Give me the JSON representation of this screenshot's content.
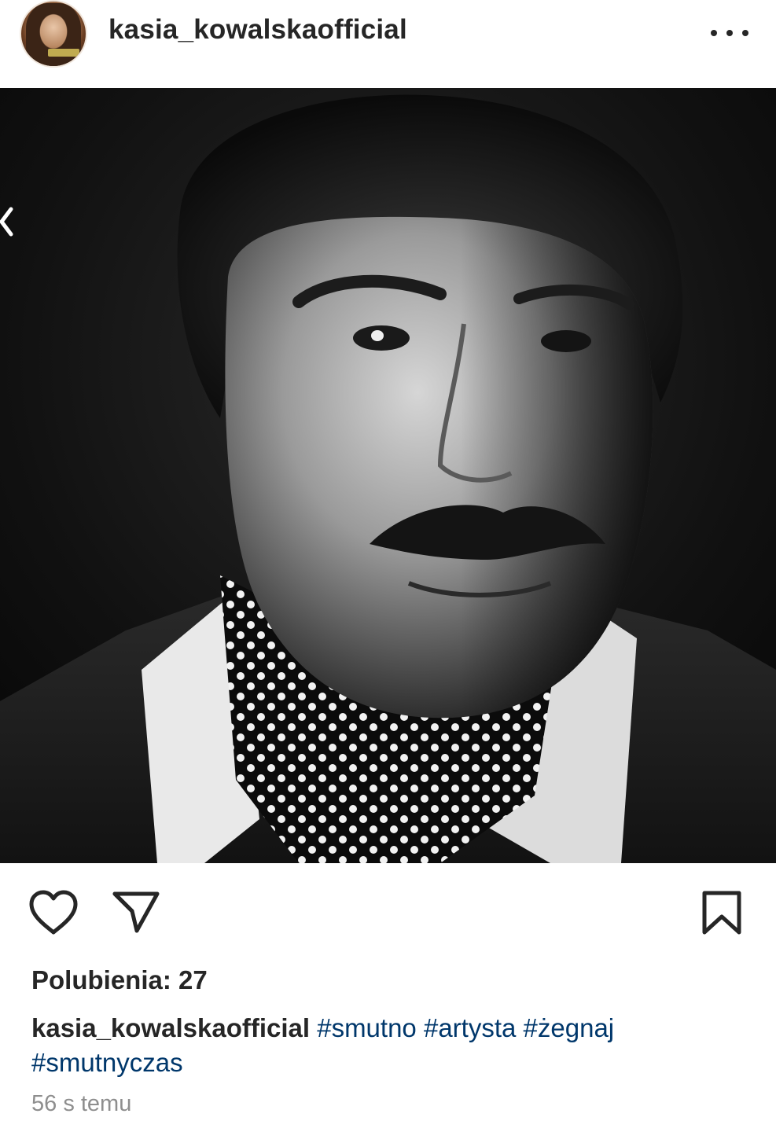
{
  "header": {
    "username": "kasia_kowalskaofficial",
    "avatar_icon": "profile-avatar",
    "more_icon": "more-options-icon"
  },
  "post": {
    "image_description_icon": "post-photo",
    "back_icon": "chevron-left-icon"
  },
  "actions": {
    "like_icon": "heart-icon",
    "share_icon": "send-icon",
    "save_icon": "bookmark-icon"
  },
  "likes": {
    "text": "Polubienia: 27"
  },
  "caption": {
    "username": "kasia_kowalskaofficial",
    "hashtags": [
      "#smutno",
      "#artysta",
      "#żegnaj",
      "#smutnyczas"
    ]
  },
  "timestamp": "56 s temu",
  "colors": {
    "text": "#262626",
    "hashtag": "#00376b",
    "muted": "#8e8e8e",
    "background": "#ffffff"
  }
}
